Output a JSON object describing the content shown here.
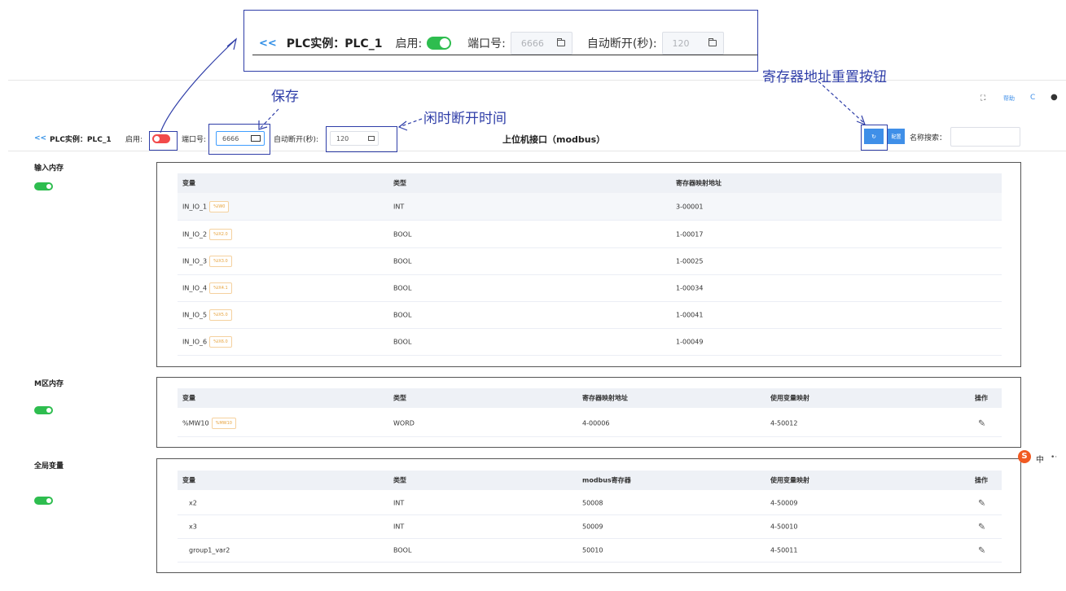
{
  "callout": {
    "back": "<<",
    "title": "PLC实例：PLC_1",
    "enable_label": "启用:",
    "port_label": "端口号:",
    "port_value": "6666",
    "auto_disconnect_label": "自动断开(秒):",
    "auto_disconnect_value": "120"
  },
  "annotations": {
    "save": "保存",
    "idle_disconnect": "闲时断开时间",
    "register_reset": "寄存器地址重置按钮"
  },
  "topbar": {
    "help": "帮助",
    "refresh": "C"
  },
  "header": {
    "back": "<<",
    "title": "PLC实例：PLC_1",
    "enable_label": "启用:",
    "port_label": "端口号:",
    "port_value": "6666",
    "auto_disconnect_label": "自动断开(秒):",
    "auto_disconnect_value": "120",
    "center_title": "上位机接口（modbus）",
    "config_button": "配置",
    "search_label": "名称搜索："
  },
  "input_memory": {
    "label": "输入内存",
    "columns": [
      "变量",
      "类型",
      "寄存器映射地址"
    ],
    "rows": [
      {
        "var": "IN_IO_1",
        "tag": "%IW0",
        "type": "INT",
        "addr": "3-00001"
      },
      {
        "var": "IN_IO_2",
        "tag": "%IX2.0",
        "type": "BOOL",
        "addr": "1-00017"
      },
      {
        "var": "IN_IO_3",
        "tag": "%IX3.0",
        "type": "BOOL",
        "addr": "1-00025"
      },
      {
        "var": "IN_IO_4",
        "tag": "%IX4.1",
        "type": "BOOL",
        "addr": "1-00034"
      },
      {
        "var": "IN_IO_5",
        "tag": "%IX5.0",
        "type": "BOOL",
        "addr": "1-00041"
      },
      {
        "var": "IN_IO_6",
        "tag": "%IX6.0",
        "type": "BOOL",
        "addr": "1-00049"
      }
    ]
  },
  "m_memory": {
    "label": "M区内存",
    "columns": [
      "变量",
      "类型",
      "寄存器映射地址",
      "使用变量映射",
      "操作"
    ],
    "rows": [
      {
        "var": "%MW10",
        "tag": "%MW10",
        "type": "WORD",
        "addr": "4-00006",
        "map": "4-50012"
      }
    ]
  },
  "global_vars": {
    "label": "全局变量",
    "columns": [
      "变量",
      "类型",
      "modbus寄存器",
      "使用变量映射",
      "操作"
    ],
    "rows": [
      {
        "var": "x2",
        "type": "INT",
        "reg": "50008",
        "map": "4-50009"
      },
      {
        "var": "x3",
        "type": "INT",
        "reg": "50009",
        "map": "4-50010"
      },
      {
        "var": "group1_var2",
        "type": "BOOL",
        "reg": "50010",
        "map": "4-50011"
      }
    ]
  },
  "ime": {
    "label": "中"
  }
}
